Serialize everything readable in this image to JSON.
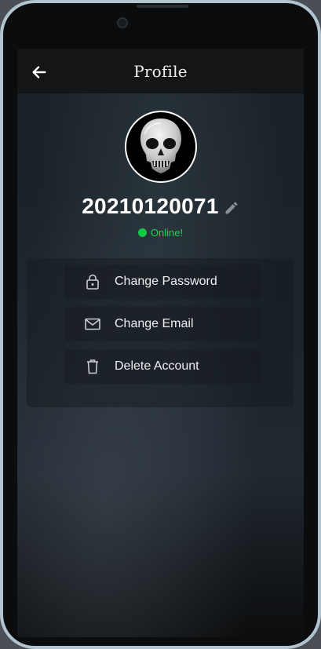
{
  "header": {
    "title": "Profile"
  },
  "profile": {
    "username": "20210120071",
    "status": "Online!",
    "status_color": "#12c945"
  },
  "menu": [
    {
      "label": "Change Password",
      "icon": "lock-icon"
    },
    {
      "label": "Change Email",
      "icon": "mail-icon"
    },
    {
      "label": "Delete Account",
      "icon": "trash-icon"
    }
  ],
  "icons": {
    "back": "arrow-left-icon",
    "edit": "pencil-icon",
    "avatar": "skull-icon"
  }
}
